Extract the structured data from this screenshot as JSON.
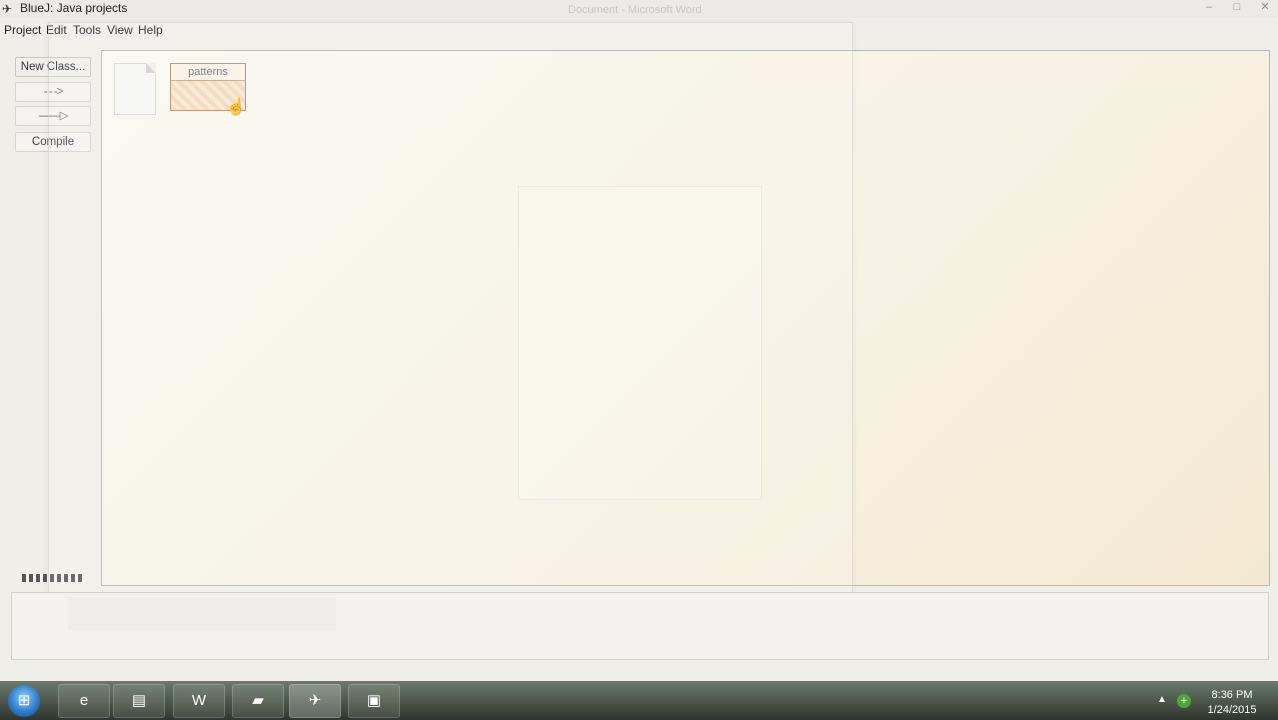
{
  "window": {
    "title": "BlueJ: Java projects",
    "ghost_title": "Document - Microsoft Word",
    "app_icon": "bluej-bird-icon",
    "controls": {
      "minimize": "–",
      "maximize": "□",
      "close": "✕"
    }
  },
  "menu": {
    "items": [
      "Project",
      "Edit",
      "Tools",
      "View",
      "Help"
    ]
  },
  "toolbar": {
    "new_class_label": "New Class...",
    "uses_arrow_label": "- - ->",
    "inherits_arrow_label": "——▷",
    "compile_label": "Compile"
  },
  "canvas": {
    "package_name": "patterns",
    "package_color": "#f3d8b8"
  },
  "taskbar": {
    "start_icon": "windows-start-icon",
    "apps": [
      {
        "name": "internet-explorer-icon",
        "glyph": "e"
      },
      {
        "name": "file-explorer-icon",
        "glyph": "▤"
      },
      {
        "name": "word-icon",
        "glyph": "W"
      },
      {
        "name": "folder-icon",
        "glyph": "▰"
      },
      {
        "name": "bluej-icon",
        "glyph": "✈"
      },
      {
        "name": "video-icon",
        "glyph": "▣"
      }
    ],
    "time": "8:36 PM",
    "date": "1/24/2015"
  }
}
